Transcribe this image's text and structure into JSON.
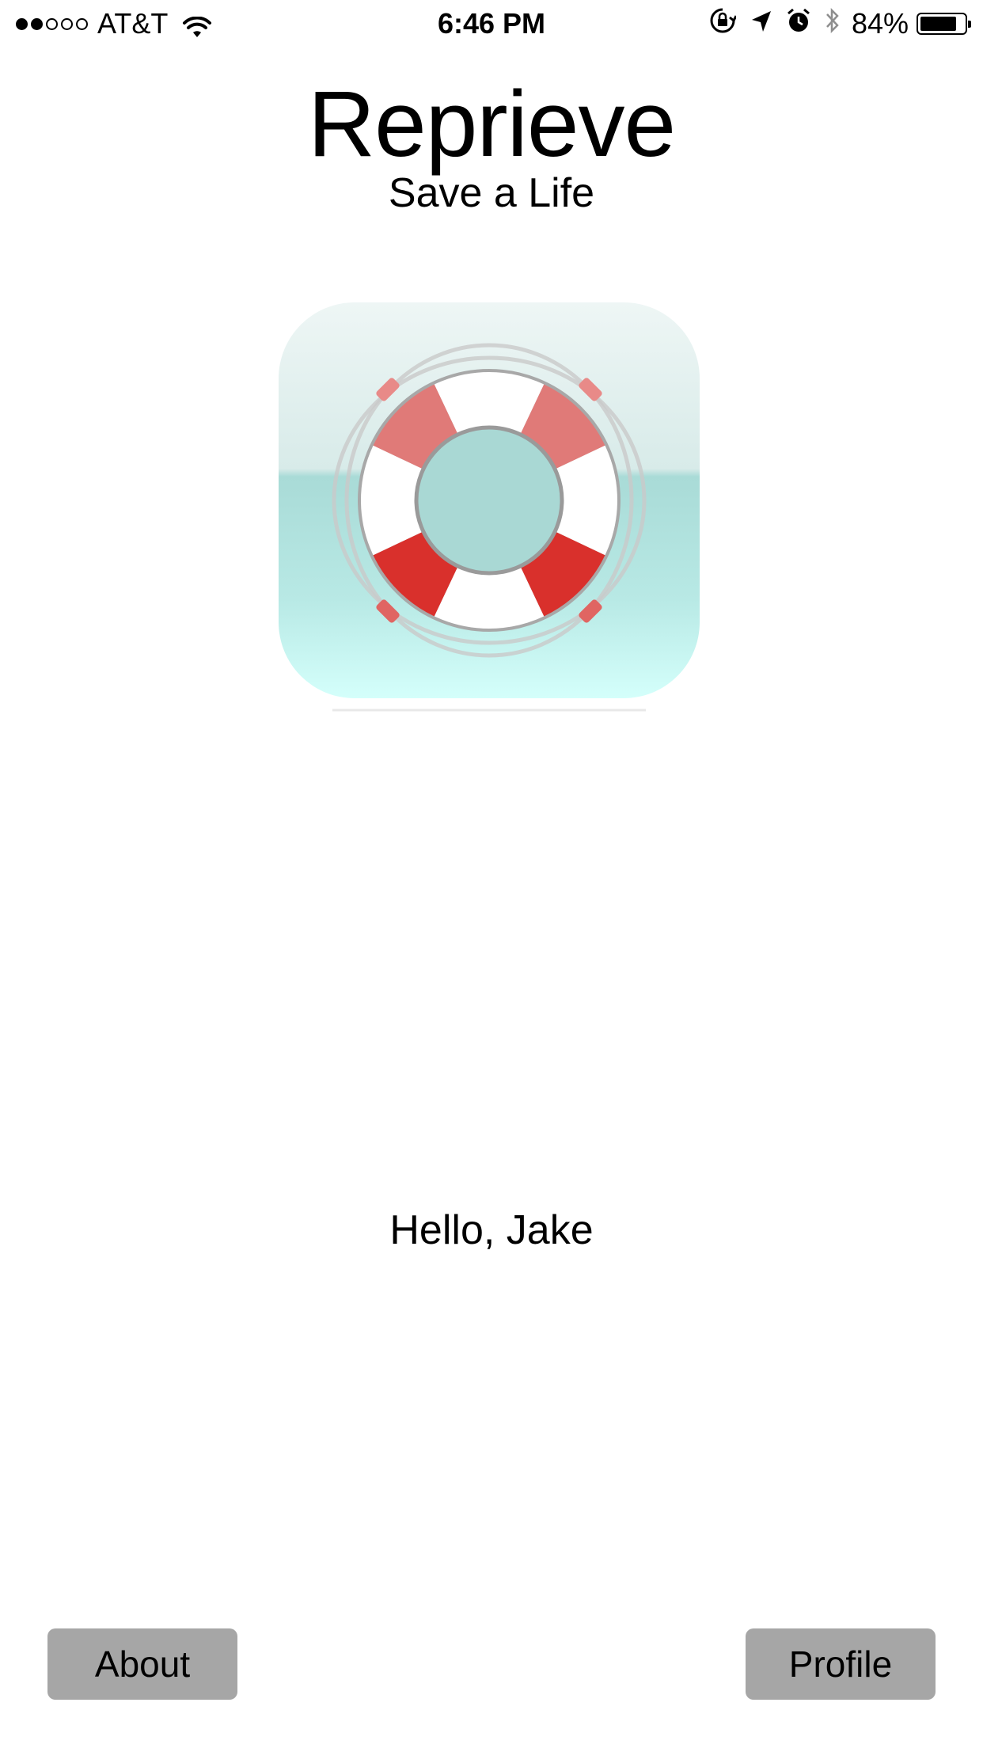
{
  "status_bar": {
    "signal_strength": 2,
    "signal_max": 5,
    "carrier": "AT&T",
    "time": "6:46 PM",
    "battery_percent": "84%",
    "battery_level": 0.84,
    "icons": [
      "wifi-icon",
      "rotation-lock-icon",
      "location-arrow-icon",
      "alarm-icon",
      "bluetooth-icon",
      "battery-icon"
    ]
  },
  "header": {
    "title": "Reprieve",
    "subtitle": "Save a Life"
  },
  "logo": {
    "icon": "life-ring-icon",
    "colors": {
      "background_top": "#eef6f5",
      "background_mid": "#a8dbd7",
      "background_bottom": "#d4fffb",
      "ring_red": "#d9302c",
      "ring_white": "#ffffff"
    }
  },
  "main": {
    "greeting": "Hello, Jake"
  },
  "footer": {
    "about_label": "About",
    "profile_label": "Profile",
    "button_color": "#a6a6a6"
  }
}
